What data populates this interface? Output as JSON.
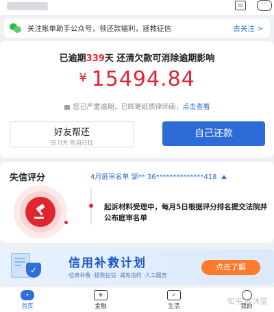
{
  "notice": {
    "text": "关注账单助手公众号，领还款福利，拯救征信",
    "link": "去关注 >"
  },
  "overdue": {
    "prefix": "已逾期",
    "days": "339",
    "suffix": "天 还清欠款可消除逾期影响"
  },
  "amount": {
    "currency": "¥",
    "value": "15494.84"
  },
  "warning": {
    "text": "您已严重逾期，已邮寄纸质律师函，",
    "link": "点击查看"
  },
  "buttons": {
    "friend_label": "好友帮还",
    "friend_sub": "压力大 别自己扛",
    "self_label": "自己还款"
  },
  "credit": {
    "title": "失信评分",
    "court_list": "4月庭审名单 邹** 36**************418",
    "process_text": "起诉材料受理中，每月5日根据评分排名提交法院并公布庭审名单"
  },
  "banner": {
    "title": "信用补救计划",
    "subtitle": "·信息补救 ·拯救征信 ·减免违约 ·人工服务",
    "button": "点击了解"
  },
  "tabbar": {
    "items": [
      {
        "label": "首页",
        "icon": "home-icon",
        "active": true
      },
      {
        "label": "金融",
        "icon": "yen-icon",
        "active": false
      },
      {
        "label": "生活",
        "icon": "life-icon",
        "active": false
      },
      {
        "label": "我的",
        "icon": "user-icon",
        "active": false
      }
    ]
  },
  "watermark": "知乎 @沐望",
  "colors": {
    "accent_red": "#e02433",
    "accent_blue": "#2d6bd9",
    "banner_button": "#ff7a2a"
  }
}
